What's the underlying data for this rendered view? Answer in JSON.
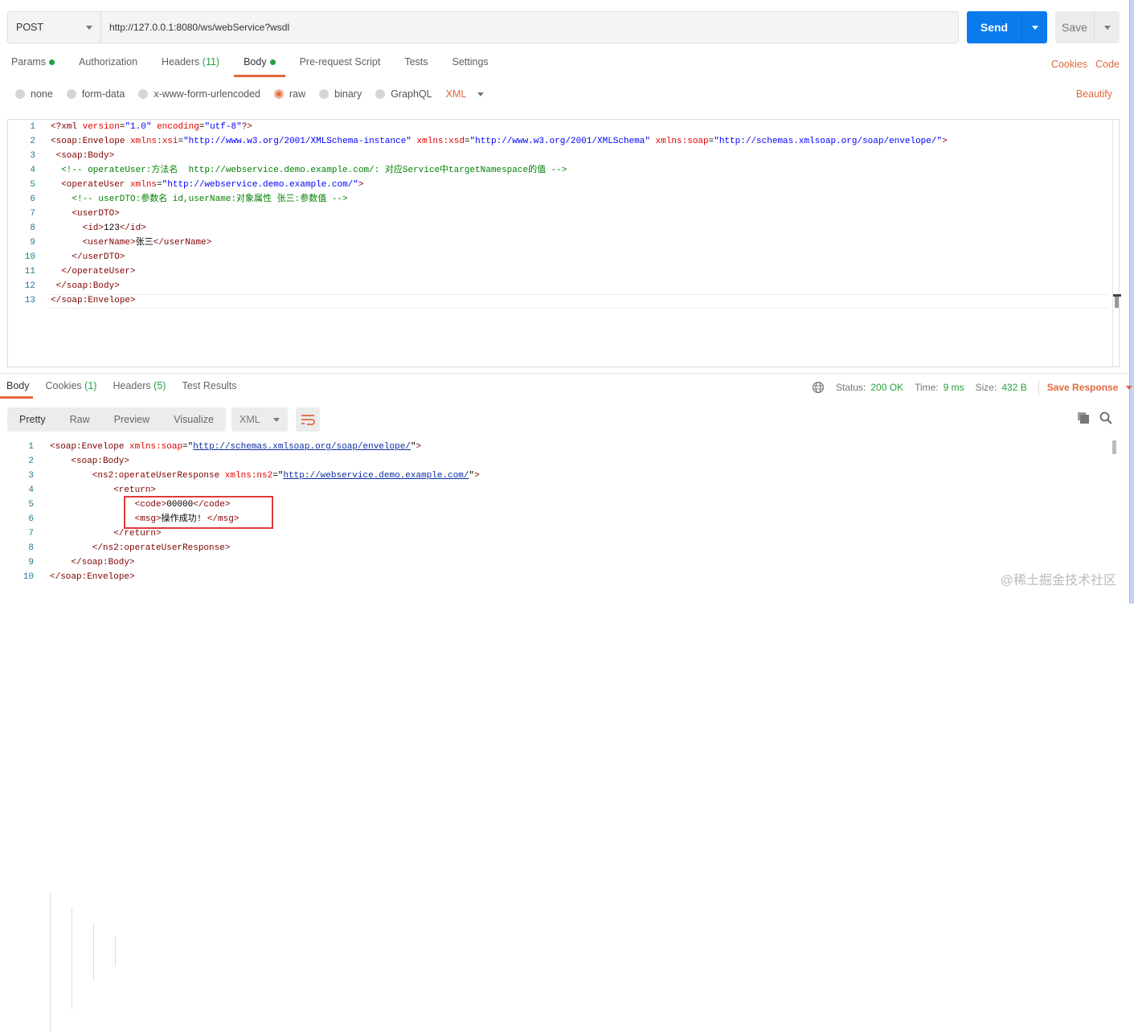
{
  "request": {
    "method": "POST",
    "url": "http://127.0.0.1:8080/ws/webService?wsdl",
    "send_label": "Send",
    "save_label": "Save",
    "tabs": [
      {
        "label": "Params",
        "dot": true
      },
      {
        "label": "Authorization"
      },
      {
        "label": "Headers",
        "count": "(11)"
      },
      {
        "label": "Body",
        "dot": true,
        "active": true
      },
      {
        "label": "Pre-request Script"
      },
      {
        "label": "Tests"
      },
      {
        "label": "Settings"
      }
    ],
    "cookies_link": "Cookies",
    "code_link": "Code",
    "body_types": [
      "none",
      "form-data",
      "x-www-form-urlencoded",
      "raw",
      "binary",
      "GraphQL"
    ],
    "body_selected": "raw",
    "body_format": "XML",
    "beautify_label": "Beautify",
    "code_lines": [
      {
        "indent": 0,
        "tokens": [
          [
            "tg",
            "<?xml "
          ],
          [
            "at",
            "version"
          ],
          [
            "tx",
            "="
          ],
          [
            "st",
            "\"1.0\""
          ],
          [
            "tx",
            " "
          ],
          [
            "at",
            "encoding"
          ],
          [
            "tx",
            "="
          ],
          [
            "st",
            "\"utf-8\""
          ],
          [
            "tg",
            "?>"
          ]
        ]
      },
      {
        "indent": 0,
        "tokens": [
          [
            "tg",
            "<soap:Envelope "
          ],
          [
            "at",
            "xmlns:xsi"
          ],
          [
            "tx",
            "="
          ],
          [
            "st",
            "\"http://www.w3.org/2001/XMLSchema-instance\""
          ],
          [
            "tx",
            " "
          ],
          [
            "at",
            "xmlns:xsd"
          ],
          [
            "tx",
            "="
          ],
          [
            "st",
            "\"http://www.w3.org/2001/XMLSchema\""
          ],
          [
            "tx",
            " "
          ],
          [
            "at",
            "xmlns:soap"
          ],
          [
            "tx",
            "="
          ],
          [
            "st",
            "\"http://schemas.xmlsoap.org/soap/envelope/\""
          ],
          [
            "tg",
            ">"
          ]
        ]
      },
      {
        "indent": 1,
        "tokens": [
          [
            "tg",
            "<soap:Body>"
          ]
        ]
      },
      {
        "indent": 2,
        "tokens": [
          [
            "cm",
            "<!-- operateUser:方法名  http://webservice.demo.example.com/: 对应Service中targetNamespace的值 -->"
          ]
        ]
      },
      {
        "indent": 2,
        "tokens": [
          [
            "tg",
            "<operateUser "
          ],
          [
            "at",
            "xmlns"
          ],
          [
            "tx",
            "="
          ],
          [
            "st",
            "\"http://webservice.demo.example.com/\""
          ],
          [
            "tg",
            ">"
          ]
        ]
      },
      {
        "indent": 4,
        "tokens": [
          [
            "cm",
            "<!-- userDTO:参数名 id,userName:对象属性 张三:参数值 -->"
          ]
        ]
      },
      {
        "indent": 4,
        "tokens": [
          [
            "tg",
            "<userDTO>"
          ]
        ]
      },
      {
        "indent": 6,
        "tokens": [
          [
            "tg",
            "<id>"
          ],
          [
            "tx",
            "123"
          ],
          [
            "tg",
            "</id>"
          ]
        ]
      },
      {
        "indent": 6,
        "tokens": [
          [
            "tg",
            "<userName>"
          ],
          [
            "tx",
            "张三"
          ],
          [
            "tg",
            "</userName>"
          ]
        ]
      },
      {
        "indent": 4,
        "tokens": [
          [
            "tg",
            "</userDTO>"
          ]
        ]
      },
      {
        "indent": 2,
        "tokens": [
          [
            "tg",
            "</operateUser>"
          ]
        ]
      },
      {
        "indent": 1,
        "tokens": [
          [
            "tg",
            "</soap:Body>"
          ]
        ]
      },
      {
        "indent": 0,
        "tokens": [
          [
            "tg",
            "</soap:Envelope>"
          ]
        ]
      }
    ]
  },
  "response": {
    "tabs": [
      {
        "label": "Body",
        "active": true
      },
      {
        "label": "Cookies",
        "count": "(1)"
      },
      {
        "label": "Headers",
        "count": "(5)"
      },
      {
        "label": "Test Results"
      }
    ],
    "status_label": "Status:",
    "status": "200 OK",
    "time_label": "Time:",
    "time": "9 ms",
    "size_label": "Size:",
    "size": "432 B",
    "save_response_label": "Save Response",
    "view_modes": [
      "Pretty",
      "Raw",
      "Preview",
      "Visualize"
    ],
    "view_selected": "Pretty",
    "format": "XML",
    "code_lines": [
      {
        "indent": 0,
        "tokens": [
          [
            "tg",
            "<soap:Envelope "
          ],
          [
            "at",
            "xmlns:soap"
          ],
          [
            "tx",
            "="
          ],
          [
            "tx",
            "\""
          ],
          [
            "lk",
            "http://schemas.xmlsoap.org/soap/envelope/"
          ],
          [
            "tx",
            "\""
          ],
          [
            "tg",
            ">"
          ]
        ]
      },
      {
        "indent": 4,
        "tokens": [
          [
            "tg",
            "<soap:Body>"
          ]
        ]
      },
      {
        "indent": 8,
        "tokens": [
          [
            "tg",
            "<ns2:operateUserResponse "
          ],
          [
            "at",
            "xmlns:ns2"
          ],
          [
            "tx",
            "="
          ],
          [
            "tx",
            "\""
          ],
          [
            "lk",
            "http://webservice.demo.example.com/"
          ],
          [
            "tx",
            "\""
          ],
          [
            "tg",
            ">"
          ]
        ]
      },
      {
        "indent": 12,
        "tokens": [
          [
            "tg",
            "<return>"
          ]
        ]
      },
      {
        "indent": 16,
        "tokens": [
          [
            "tg",
            "<code>"
          ],
          [
            "tx",
            "00000"
          ],
          [
            "tg",
            "</code>"
          ]
        ]
      },
      {
        "indent": 16,
        "tokens": [
          [
            "tg",
            "<msg>"
          ],
          [
            "tx",
            "操作成功! "
          ],
          [
            "tg",
            "</msg>"
          ]
        ]
      },
      {
        "indent": 12,
        "tokens": [
          [
            "tg",
            "</return>"
          ]
        ]
      },
      {
        "indent": 8,
        "tokens": [
          [
            "tg",
            "</ns2:operateUserResponse>"
          ]
        ]
      },
      {
        "indent": 4,
        "tokens": [
          [
            "tg",
            "</soap:Body>"
          ]
        ]
      },
      {
        "indent": 0,
        "tokens": [
          [
            "tg",
            "</soap:Envelope>"
          ]
        ]
      }
    ]
  },
  "watermark": "@稀土掘金技术社区",
  "colors": {
    "accent": "#e0683e",
    "send": "#097bed",
    "success": "#26a140"
  }
}
